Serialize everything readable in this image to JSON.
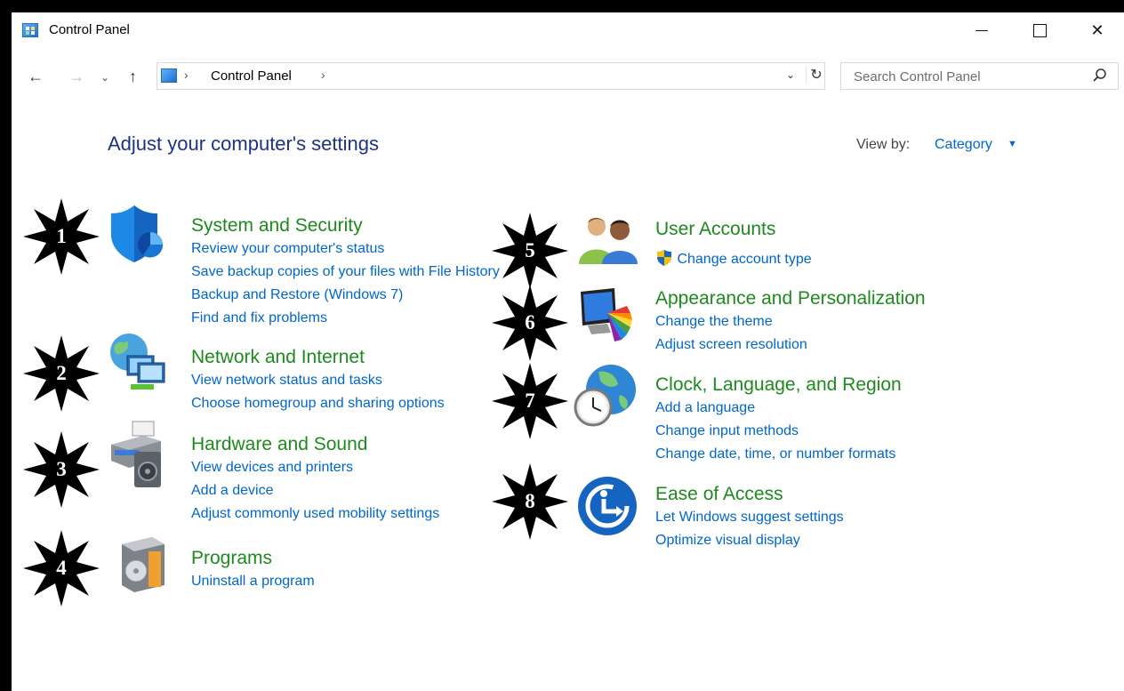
{
  "window": {
    "title": "Control Panel"
  },
  "titlebar_buttons": {
    "minimize": "—",
    "maximize": "",
    "close": "✕"
  },
  "nav": {
    "back": "←",
    "forward": "→",
    "recent": "⌄",
    "up": "↑",
    "refresh": "↻",
    "dropdown": "⌄"
  },
  "address": {
    "separator": "›",
    "path": "Control Panel"
  },
  "search": {
    "placeholder": "Search Control Panel"
  },
  "header": {
    "title": "Adjust your computer's settings",
    "view_by_label": "View by:",
    "view_by_value": "Category"
  },
  "left_categories": [
    {
      "title": "System and Security",
      "icon": "shield-icon",
      "links": [
        "Review your computer's status",
        "Save backup copies of your files with File History",
        "Backup and Restore (Windows 7)",
        "Find and fix problems"
      ]
    },
    {
      "title": "Network and Internet",
      "icon": "network-icon",
      "links": [
        "View network status and tasks",
        "Choose homegroup and sharing options"
      ]
    },
    {
      "title": "Hardware and Sound",
      "icon": "printer-icon",
      "links": [
        "View devices and printers",
        "Add a device",
        "Adjust commonly used mobility settings"
      ]
    },
    {
      "title": "Programs",
      "icon": "programs-icon",
      "links": [
        "Uninstall a program"
      ]
    }
  ],
  "right_categories": [
    {
      "title": "User Accounts",
      "icon": "users-icon",
      "links": [
        "Change account type"
      ]
    },
    {
      "title": "Appearance and Personalization",
      "icon": "monitor-palette-icon",
      "links": [
        "Change the theme",
        "Adjust screen resolution"
      ]
    },
    {
      "title": "Clock, Language, and Region",
      "icon": "globe-clock-icon",
      "links": [
        "Add a language",
        "Change input methods",
        "Change date, time, or number formats"
      ]
    },
    {
      "title": "Ease of Access",
      "icon": "ease-of-access-icon",
      "links": [
        "Let Windows suggest settings",
        "Optimize visual display"
      ]
    }
  ],
  "markers": [
    "1",
    "2",
    "3",
    "4",
    "5",
    "6",
    "7",
    "8"
  ],
  "colors": {
    "category_title": "#1d8a1d",
    "link": "#0066cc",
    "page_title": "#1e3287",
    "marker": "#000000"
  }
}
